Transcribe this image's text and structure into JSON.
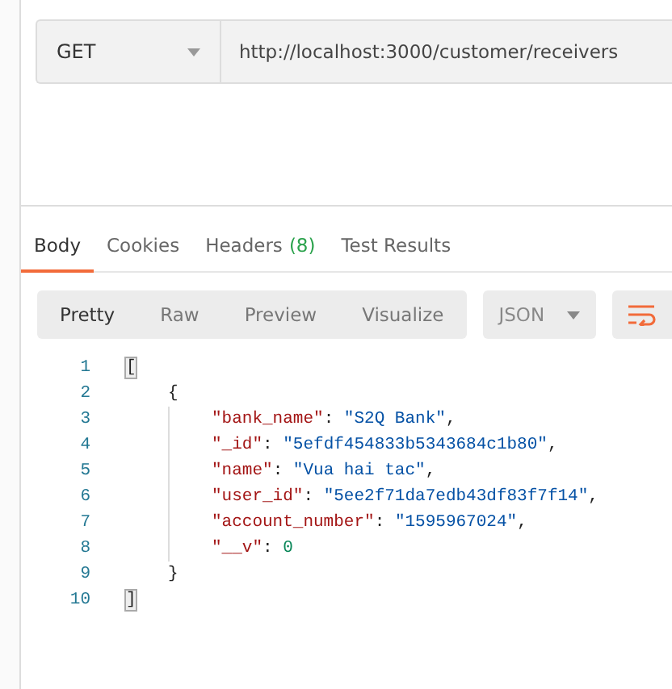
{
  "request": {
    "method": "GET",
    "url": "http://localhost:3000/customer/receivers"
  },
  "response_tabs": [
    {
      "label": "Body",
      "selected": true
    },
    {
      "label": "Cookies",
      "selected": false
    },
    {
      "label": "Headers",
      "count": "(8)",
      "selected": false
    },
    {
      "label": "Test Results",
      "selected": false
    }
  ],
  "view_modes": [
    {
      "label": "Pretty",
      "selected": true
    },
    {
      "label": "Raw",
      "selected": false
    },
    {
      "label": "Preview",
      "selected": false
    },
    {
      "label": "Visualize",
      "selected": false
    }
  ],
  "format": {
    "label": "JSON"
  },
  "lines": [
    {
      "number": "1",
      "tokens": [
        {
          "kind": "open",
          "text": "[",
          "highlighted": true
        }
      ]
    },
    {
      "number": "2",
      "tokens": [
        {
          "kind": "open",
          "text": "{",
          "highlighted": false
        }
      ]
    },
    {
      "number": "3",
      "tokens": [
        {
          "kind": "key",
          "text": "\"bank_name\""
        },
        {
          "kind": "punct",
          "text": ": "
        },
        {
          "kind": "string",
          "text": "\"S2Q Bank\""
        },
        {
          "kind": "punct",
          "text": ","
        }
      ]
    },
    {
      "number": "4",
      "tokens": [
        {
          "kind": "key",
          "text": "\"_id\""
        },
        {
          "kind": "punct",
          "text": ": "
        },
        {
          "kind": "string",
          "text": "\"5efdf454833b5343684c1b80\""
        },
        {
          "kind": "punct",
          "text": ","
        }
      ]
    },
    {
      "number": "5",
      "tokens": [
        {
          "kind": "key",
          "text": "\"name\""
        },
        {
          "kind": "punct",
          "text": ": "
        },
        {
          "kind": "string",
          "text": "\"Vua hai tac\""
        },
        {
          "kind": "punct",
          "text": ","
        }
      ]
    },
    {
      "number": "6",
      "tokens": [
        {
          "kind": "key",
          "text": "\"user_id\""
        },
        {
          "kind": "punct",
          "text": ": "
        },
        {
          "kind": "string",
          "text": "\"5ee2f71da7edb43df83f7f14\""
        },
        {
          "kind": "punct",
          "text": ","
        }
      ]
    },
    {
      "number": "7",
      "tokens": [
        {
          "kind": "key",
          "text": "\"account_number\""
        },
        {
          "kind": "punct",
          "text": ": "
        },
        {
          "kind": "string",
          "text": "\"1595967024\""
        },
        {
          "kind": "punct",
          "text": ","
        }
      ]
    },
    {
      "number": "8",
      "tokens": [
        {
          "kind": "key",
          "text": "\"__v\""
        },
        {
          "kind": "punct",
          "text": ": "
        },
        {
          "kind": "number",
          "text": "0"
        }
      ]
    },
    {
      "number": "9",
      "tokens": [
        {
          "kind": "close",
          "text": "}",
          "highlighted": false
        }
      ]
    },
    {
      "number": "10",
      "tokens": [
        {
          "kind": "close",
          "text": "]",
          "highlighted": true
        }
      ]
    }
  ]
}
